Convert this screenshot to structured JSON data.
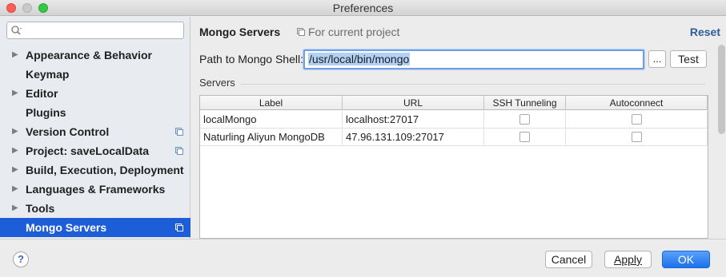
{
  "window": {
    "title": "Preferences"
  },
  "sidebar": {
    "search_placeholder": "",
    "items": [
      {
        "label": "Appearance & Behavior",
        "expandable": true,
        "project_icon": false,
        "selected": false
      },
      {
        "label": "Keymap",
        "expandable": false,
        "project_icon": false,
        "selected": false
      },
      {
        "label": "Editor",
        "expandable": true,
        "project_icon": false,
        "selected": false
      },
      {
        "label": "Plugins",
        "expandable": false,
        "project_icon": false,
        "selected": false
      },
      {
        "label": "Version Control",
        "expandable": true,
        "project_icon": true,
        "selected": false
      },
      {
        "label": "Project: saveLocalData",
        "expandable": true,
        "project_icon": true,
        "selected": false
      },
      {
        "label": "Build, Execution, Deployment",
        "expandable": true,
        "project_icon": false,
        "selected": false
      },
      {
        "label": "Languages & Frameworks",
        "expandable": true,
        "project_icon": false,
        "selected": false
      },
      {
        "label": "Tools",
        "expandable": true,
        "project_icon": false,
        "selected": false
      },
      {
        "label": "Mongo Servers",
        "expandable": false,
        "project_icon": true,
        "selected": true
      }
    ]
  },
  "content": {
    "title": "Mongo Servers",
    "scope": "For current project",
    "reset": "Reset",
    "path_label": "Path to Mongo Shell:",
    "path_value": "/usr/local/bin/mongo",
    "browse_label": "...",
    "test_label": "Test",
    "servers_label": "Servers",
    "table": {
      "columns": [
        "Label",
        "URL",
        "SSH Tunneling",
        "Autoconnect"
      ],
      "rows": [
        {
          "label": "localMongo",
          "url": "localhost:27017",
          "ssh": false,
          "autoconnect": false
        },
        {
          "label": "Naturling Aliyun MongoDB",
          "url": "47.96.131.109:27017",
          "ssh": false,
          "autoconnect": false
        }
      ]
    }
  },
  "footer": {
    "help": "?",
    "cancel": "Cancel",
    "apply": "Apply",
    "ok": "OK"
  },
  "colors": {
    "selection": "#1d5dd7",
    "ok_button": "#1b72ec",
    "reset_link": "#2f5d9b"
  }
}
